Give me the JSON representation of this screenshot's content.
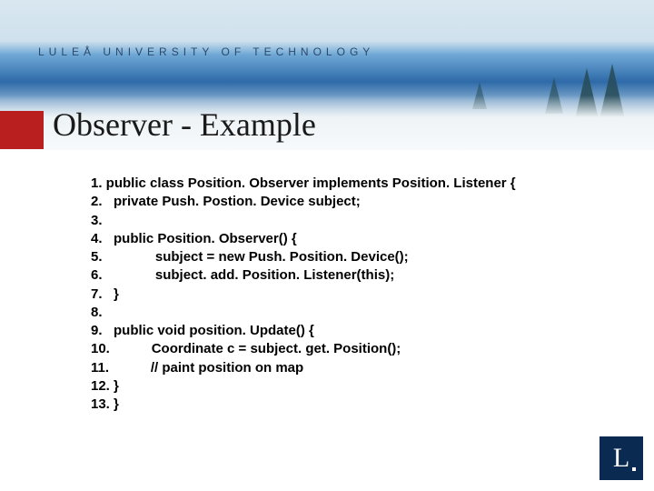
{
  "university": "LULEÅ  UNIVERSITY  OF  TECHNOLOGY",
  "title": "Observer - Example",
  "code_lines": [
    "1. public class Position. Observer implements Position. Listener {",
    "2.   private Push. Postion. Device subject;",
    "3.",
    "4.   public Position. Observer() {",
    "5.              subject = new Push. Position. Device();",
    "6.              subject. add. Position. Listener(this);",
    "7.   }",
    "8.",
    "9.   public void position. Update() {",
    "10.           Coordinate c = subject. get. Position();",
    "11.           // paint position on map",
    "12. }",
    "13. }"
  ],
  "logo_letter": "L"
}
